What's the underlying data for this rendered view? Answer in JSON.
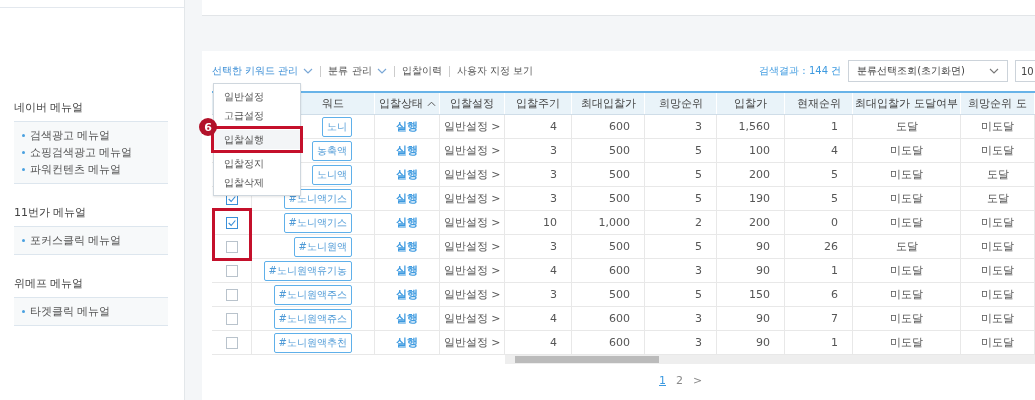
{
  "sidebar": {
    "sections": [
      {
        "title": "네이버 메뉴얼",
        "items": [
          "검색광고 메뉴얼",
          "쇼핑검색광고 메뉴얼",
          "파워컨텐츠 메뉴얼"
        ]
      },
      {
        "title": "11번가 메뉴얼",
        "items": [
          "포커스클릭 메뉴얼"
        ]
      },
      {
        "title": "위메프 메뉴얼",
        "items": [
          "타겟클릭 메뉴얼"
        ]
      }
    ]
  },
  "toolbar": {
    "actions": [
      {
        "label": "선택한 키워드 관리",
        "dropdown": true,
        "selected": true
      },
      {
        "label": "분류 관리",
        "dropdown": true,
        "selected": false
      },
      {
        "label": "입찰이력",
        "dropdown": false,
        "selected": false
      },
      {
        "label": "사용자 지정 보기",
        "dropdown": false,
        "selected": false
      }
    ],
    "result_count": "검색결과 : 144 건",
    "filter_select": "분류선택조회(초기화면)",
    "page_size_select": "10"
  },
  "menu": {
    "items": [
      {
        "label": "일반설정",
        "highlighted": false
      },
      {
        "label": "고급설정",
        "highlighted": false
      },
      {
        "label": "입찰실행",
        "highlighted": true
      },
      {
        "label": "입찰정지",
        "highlighted": false
      },
      {
        "label": "입찰삭제",
        "highlighted": false
      }
    ],
    "callout": "6"
  },
  "table": {
    "columns": [
      {
        "label": "워드",
        "kind": "tag"
      },
      {
        "label": "입찰상태",
        "kind": "link",
        "sort_ascending": true
      },
      {
        "label": "입찰설정",
        "kind": "setting"
      },
      {
        "label": "입찰주기",
        "kind": "number"
      },
      {
        "label": "최대입찰가",
        "kind": "number"
      },
      {
        "label": "희망순위",
        "kind": "number"
      },
      {
        "label": "입찰가",
        "kind": "number"
      },
      {
        "label": "현재순위",
        "kind": "number"
      },
      {
        "label": "최대입찰가 도달여부",
        "kind": "text"
      },
      {
        "label": "희망순위 도",
        "kind": "text"
      }
    ],
    "rows": [
      {
        "cells": [
          "노니",
          "실행",
          "일반설정 >",
          "4",
          "600",
          "3",
          "1,560",
          "1",
          "도달",
          "미도달"
        ]
      },
      {
        "cells": [
          "농축액",
          "실행",
          "일반설정 >",
          "3",
          "500",
          "5",
          "100",
          "4",
          "미도달",
          "미도달"
        ]
      },
      {
        "cells": [
          "노니액",
          "실행",
          "일반설정 >",
          "3",
          "500",
          "5",
          "200",
          "5",
          "미도달",
          "도달"
        ]
      },
      {
        "checked": true,
        "cells": [
          "#노니액기스",
          "실행",
          "일반설정 >",
          "3",
          "500",
          "5",
          "190",
          "5",
          "미도달",
          "도달"
        ]
      },
      {
        "checked": true,
        "highlighted": true,
        "cells": [
          "#노니액기스",
          "실행",
          "일반설정 >",
          "10",
          "1,000",
          "2",
          "200",
          "0",
          "미도달",
          "미도달"
        ]
      },
      {
        "checked": false,
        "highlighted": true,
        "cells": [
          "#노니원액",
          "실행",
          "일반설정 >",
          "3",
          "500",
          "5",
          "90",
          "26",
          "도달",
          "미도달"
        ]
      },
      {
        "checked": false,
        "cells": [
          "#노니원액유기농",
          "실행",
          "일반설정 >",
          "4",
          "600",
          "3",
          "90",
          "1",
          "미도달",
          "미도달"
        ]
      },
      {
        "checked": false,
        "cells": [
          "#노니원액주스",
          "실행",
          "일반설정 >",
          "3",
          "500",
          "5",
          "150",
          "6",
          "미도달",
          "미도달"
        ]
      },
      {
        "checked": false,
        "cells": [
          "#노니원액쥬스",
          "실행",
          "일반설정 >",
          "4",
          "600",
          "3",
          "90",
          "7",
          "미도달",
          "미도달"
        ]
      },
      {
        "checked": false,
        "cells": [
          "#노니원액추천",
          "실행",
          "일반설정 >",
          "4",
          "600",
          "3",
          "90",
          "1",
          "미도달",
          "미도달"
        ]
      }
    ]
  },
  "pagination": [
    {
      "label": "1",
      "selected": true
    },
    {
      "label": "2",
      "selected": false
    },
    {
      "label": ">",
      "selected": false
    }
  ]
}
